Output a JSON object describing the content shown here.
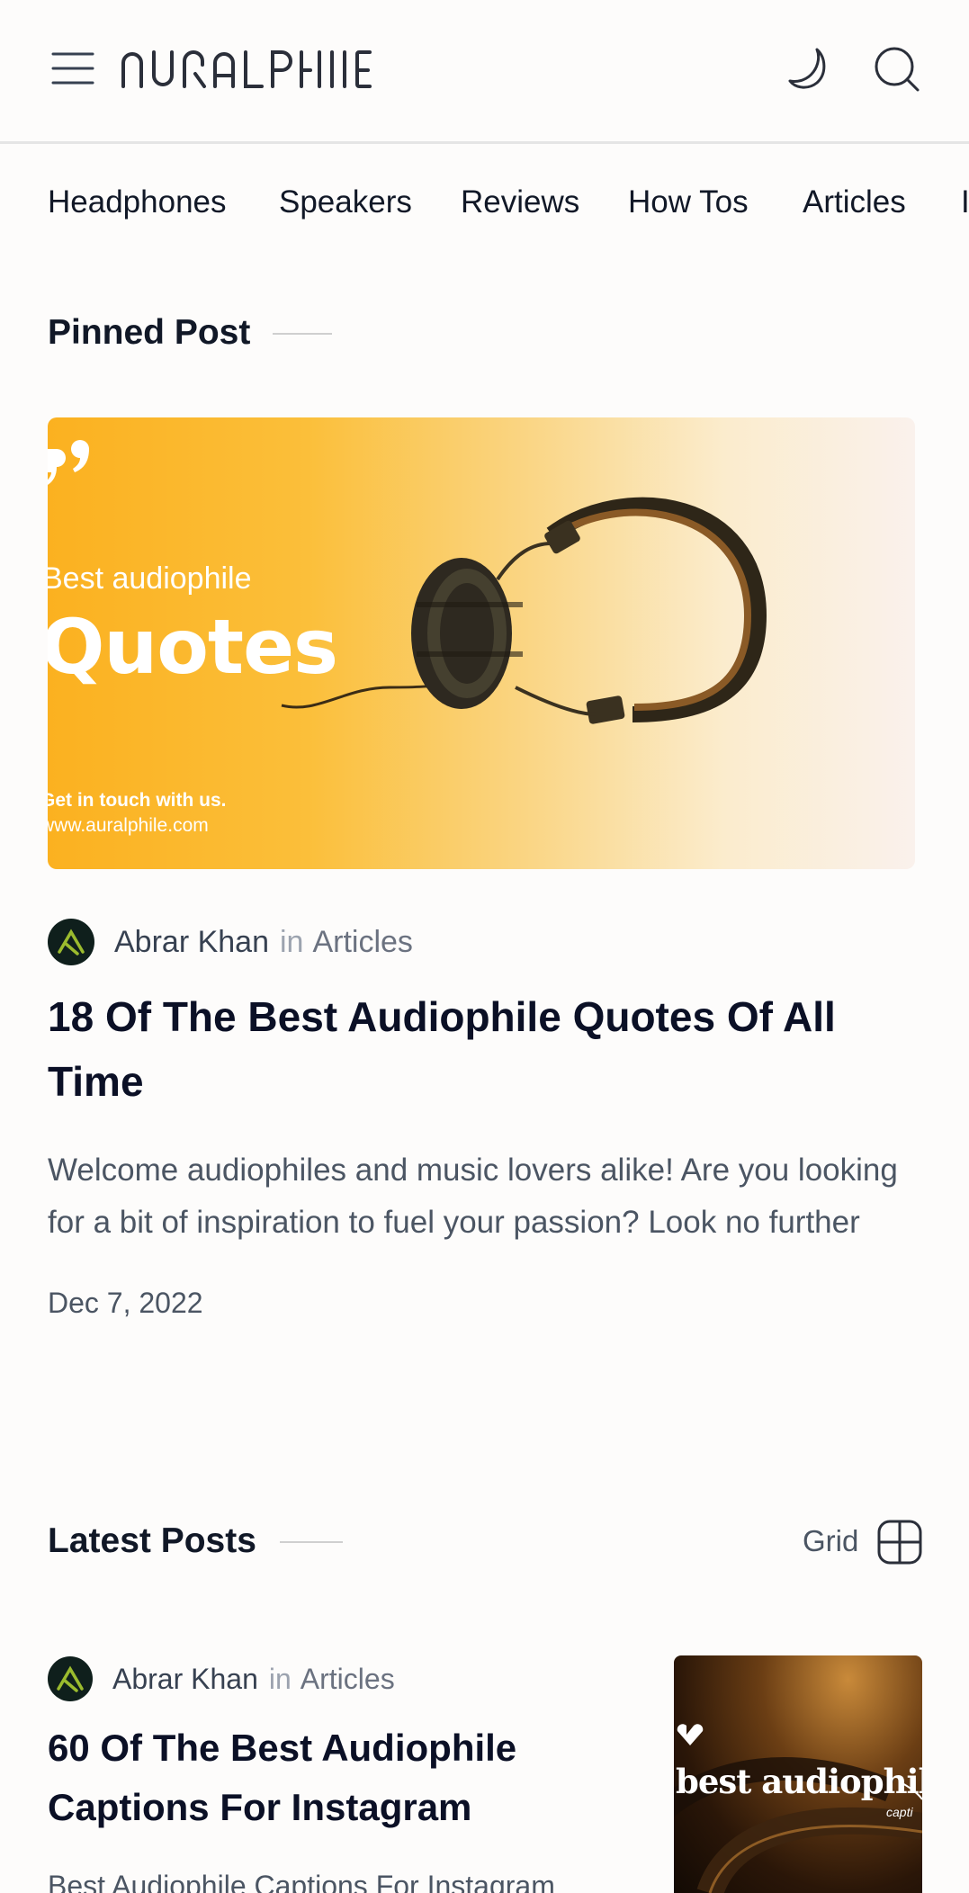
{
  "header": {
    "logo_text": "AURALPHILE"
  },
  "categories": [
    "Headphones",
    "Speakers",
    "Reviews",
    "How Tos",
    "Articles",
    "I"
  ],
  "pinned": {
    "section_title": "Pinned Post",
    "image": {
      "kicker": "Best audiophile",
      "headline": "Quotes",
      "contact": "Get in touch with us.",
      "url": "www.auralphile.com"
    },
    "author": "Abrar Khan",
    "in_word": "in",
    "category": "Articles",
    "title": "18 Of The Best Audiophile Quotes Of All Time",
    "excerpt": "Welcome audiophiles and music lovers alike! Are you looking for a bit of inspiration to fuel your passion? Look no further",
    "date": "Dec 7, 2022"
  },
  "latest": {
    "section_title": "Latest Posts",
    "view_label": "Grid",
    "posts": [
      {
        "author": "Abrar Khan",
        "in_word": "in",
        "category": "Articles",
        "title": "60 Of The Best Audiophile Captions For Instagram",
        "excerpt": "Best Audiophile Captions For Instagram",
        "thumb_text": "best audiophile",
        "thumb_sub": "capti"
      }
    ]
  },
  "colors": {
    "background": "#fdfcfb",
    "title": "#0b1026",
    "muted": "#6b7280",
    "hero_yellow": "#fbb120"
  }
}
